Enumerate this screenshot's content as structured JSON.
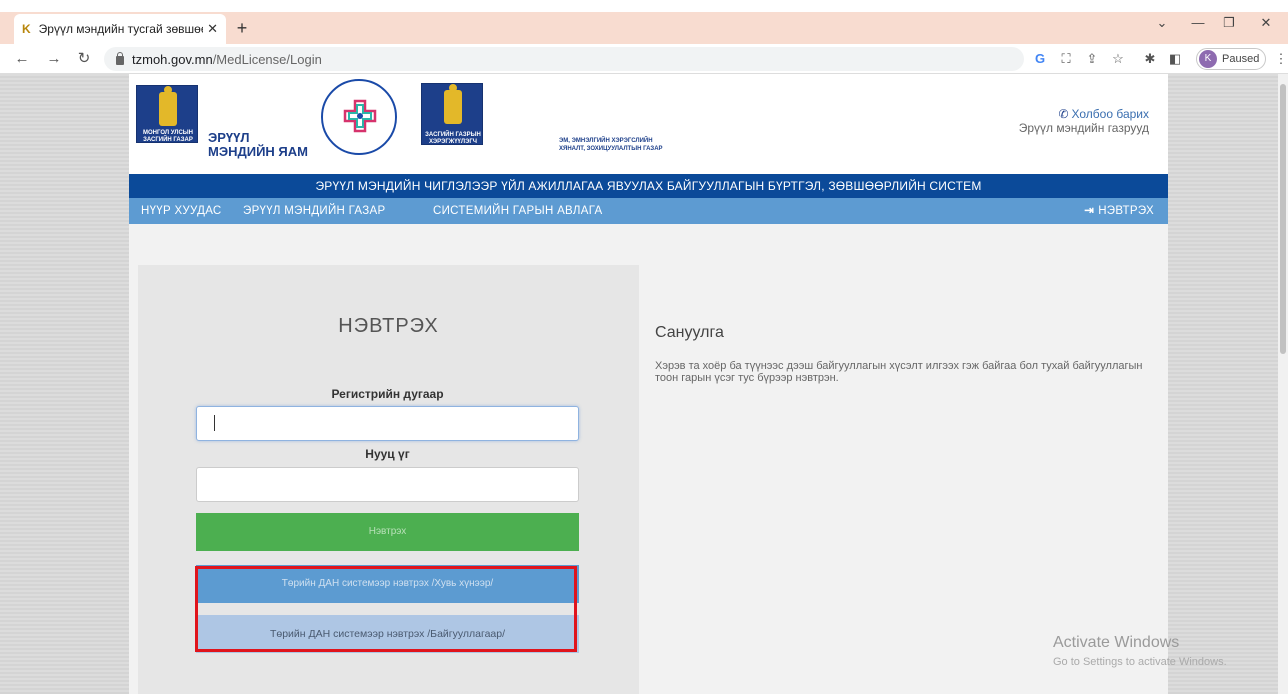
{
  "browser": {
    "tab_title": "Эрүүл мэндийн тусгай зөвшөөр",
    "tab_favicon": "K",
    "url_host": "tzmoh.gov.mn",
    "url_path": "/MedLicense/Login",
    "profile_initial": "K",
    "profile_status": "Paused",
    "icons": [
      "back-icon",
      "forward-icon",
      "reload-icon",
      "lock-icon",
      "google-icon",
      "translate-icon",
      "share-icon",
      "star-icon",
      "extensions-icon",
      "sidepanel-icon",
      "menu-icon"
    ]
  },
  "header": {
    "emblem_text": "МОНГОЛ УЛСЫН ЗАСГИЙН ГАЗАР",
    "ministry_line1": "ЭРҮҮЛ",
    "ministry_line2": "МЭНДИЙН ЯАМ",
    "agency_emblem_text": "ЗАСГИЙН ГАЗРЫН ХЭРЭГЖҮҮЛЭГЧ АГЕНТЛАГ",
    "agency_line1": "ЭМ, ЭМНЭЛГИЙН ХЭРЭГСЛИЙН",
    "agency_line2": "ХЯНАЛТ, ЗОХИЦУУЛАЛТЫН ГАЗАР",
    "contact_link": "Холбоо барих",
    "contact_sub": "Эрүүл мэндийн газрууд"
  },
  "site_title": "ЭРҮҮЛ МЭНДИЙН ЧИГЛЭЛЭЭР ҮЙЛ АЖИЛЛАГАА ЯВУУЛАХ БАЙГУУЛЛАГЫН БҮРТГЭЛ, ЗӨВШӨӨРЛИЙН СИСТЕМ",
  "nav": {
    "items": [
      "НҮҮР ХУУДАС",
      "ЭРҮҮЛ МЭНДИЙН ГАЗАР",
      "СИСТЕМИЙН ГАРЫН АВЛАГА"
    ],
    "login": "НЭВТРЭХ"
  },
  "login": {
    "title": "НЭВТРЭХ",
    "register_label": "Регистрийн дугаар",
    "register_value": "",
    "password_label": "Нууц үг",
    "password_value": "",
    "submit_label": "Нэвтрэх",
    "dan_personal_label": "Төрийн ДАН системээр нэвтрэх /Хувь хүнээр/",
    "dan_org_label": "Төрийн ДАН системээр нэвтрэх /Байгууллагаар/"
  },
  "notice": {
    "title": "Сануулга",
    "text": "Хэрэв та хоёр ба түүнээс дээш байгууллагын хүсэлт илгээх гэж байгаа бол тухай байгууллагын тоон гарын үсэг тус бүрээр нэвтрэн."
  },
  "watermark": {
    "title": "Activate Windows",
    "subtitle": "Go to Settings to activate Windows."
  },
  "colors": {
    "title_bar": "#0b4a99",
    "navbar": "#5d9bd2",
    "submit": "#4caf50",
    "dan_personal": "#5c9bd1",
    "dan_org": "#aec6e4",
    "highlight": "#e0141c"
  }
}
